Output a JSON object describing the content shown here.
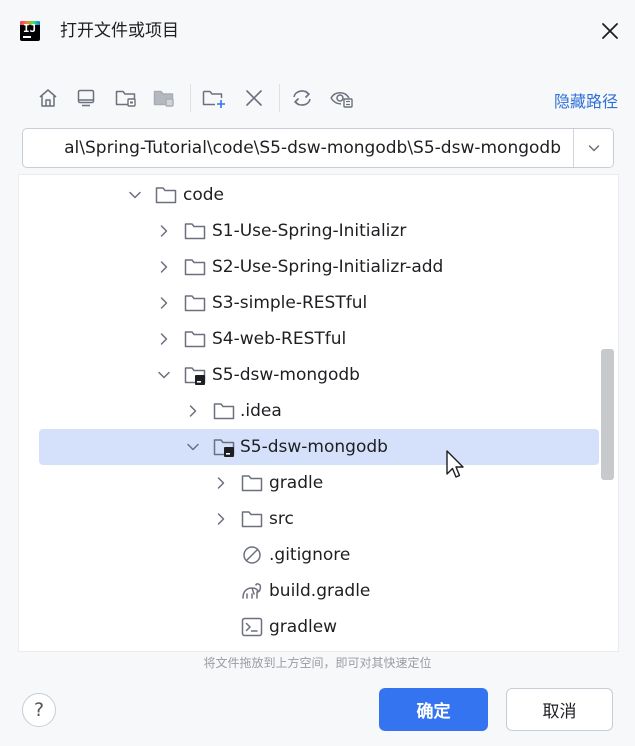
{
  "window": {
    "title": "打开文件或项目",
    "app_icon": "intellij-idea-icon",
    "close_icon": "close-icon"
  },
  "toolbar": {
    "buttons": [
      {
        "icon": "home-icon",
        "name": "home-directory-button"
      },
      {
        "icon": "desktop-icon",
        "name": "desktop-button"
      },
      {
        "icon": "project-folder-icon",
        "name": "project-directory-button"
      },
      {
        "icon": "module-folder-icon",
        "name": "module-directory-button"
      },
      {
        "icon": "new-folder-icon",
        "name": "new-folder-button"
      },
      {
        "icon": "delete-icon",
        "name": "delete-button"
      },
      {
        "icon": "refresh-icon",
        "name": "refresh-button"
      },
      {
        "icon": "show-hidden-icon",
        "name": "show-hidden-files-button"
      }
    ],
    "hide_path_label": "隐藏路径"
  },
  "path": {
    "value": "al\\Spring-Tutorial\\code\\S5-dsw-mongodb\\S5-dsw-mongodb",
    "dropdown_icon": "chevron-down-icon"
  },
  "tree": [
    {
      "label": "code",
      "expanded": true,
      "type": "folder"
    },
    {
      "label": "S1-Use-Spring-Initializr",
      "expanded": false,
      "type": "folder"
    },
    {
      "label": "S2-Use-Spring-Initializr-add",
      "expanded": false,
      "type": "folder"
    },
    {
      "label": "S3-simple-RESTful",
      "expanded": false,
      "type": "folder"
    },
    {
      "label": "S4-web-RESTful",
      "expanded": false,
      "type": "folder"
    },
    {
      "label": "S5-dsw-mongodb",
      "expanded": true,
      "type": "project-folder"
    },
    {
      "label": ".idea",
      "expanded": false,
      "type": "folder"
    },
    {
      "label": "S5-dsw-mongodb",
      "expanded": true,
      "type": "project-folder",
      "selected": true
    },
    {
      "label": "gradle",
      "expanded": false,
      "type": "folder"
    },
    {
      "label": "src",
      "expanded": false,
      "type": "folder"
    },
    {
      "label": ".gitignore",
      "type": "ignore-file"
    },
    {
      "label": "build.gradle",
      "type": "gradle-file"
    },
    {
      "label": "gradlew",
      "type": "script-file"
    }
  ],
  "hint": "将文件拖放到上方空间，即可对其快速定位",
  "footer": {
    "help_label": "?",
    "ok_label": "确定",
    "cancel_label": "取消"
  },
  "colors": {
    "accent": "#3574f0",
    "selection": "#d5e1fb",
    "link": "#2f6fd6"
  }
}
